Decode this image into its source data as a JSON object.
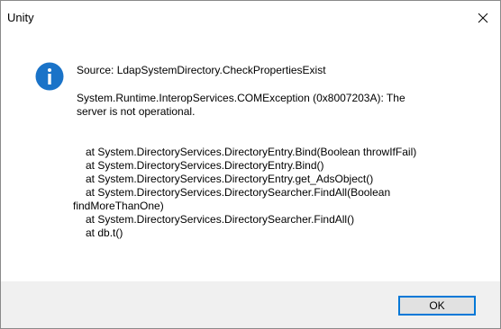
{
  "window": {
    "title": "Unity",
    "close_icon": "close-icon"
  },
  "message": {
    "icon": "info-icon",
    "icon_color": "#1a73c8",
    "source": "Source: LdapSystemDirectory.CheckPropertiesExist",
    "exception_line1": "System.Runtime.InteropServices.COMException (0x8007203A): The",
    "exception_line2": "server is not operational.",
    "trace": [
      "   at System.DirectoryServices.DirectoryEntry.Bind(Boolean throwIfFail)",
      "   at System.DirectoryServices.DirectoryEntry.Bind()",
      "   at System.DirectoryServices.DirectoryEntry.get_AdsObject()",
      "   at System.DirectoryServices.DirectorySearcher.FindAll(Boolean",
      "findMoreThanOne)",
      "   at System.DirectoryServices.DirectorySearcher.FindAll()",
      "   at db.t()"
    ]
  },
  "footer": {
    "ok_label": "OK"
  }
}
